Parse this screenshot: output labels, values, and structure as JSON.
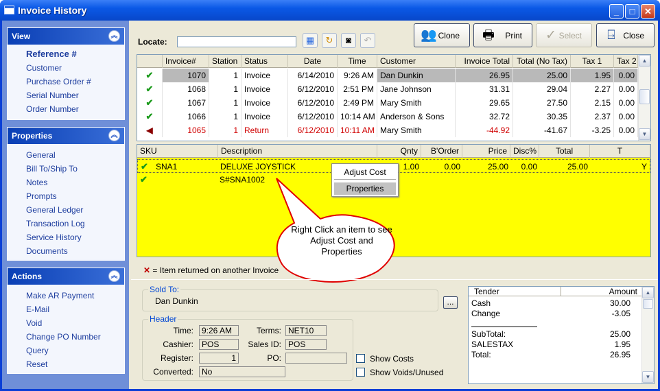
{
  "window": {
    "title": "Invoice History"
  },
  "sidebar": {
    "view": {
      "title": "View",
      "items": [
        "Reference #",
        "Customer",
        "Purchase Order #",
        "Serial Number",
        "Order Number"
      ]
    },
    "properties": {
      "title": "Properties",
      "items": [
        "General",
        "Bill To/Ship To",
        "Notes",
        "Prompts",
        "General Ledger",
        "Transaction Log",
        "Service History",
        "Documents"
      ]
    },
    "actions": {
      "title": "Actions",
      "items": [
        "Make AR Payment",
        "E-Mail",
        "Void",
        "Change PO Number",
        "Query",
        "Reset"
      ]
    }
  },
  "toolbar": {
    "locate_label": "Locate:",
    "locate_value": "",
    "clone": "Clone",
    "print": "Print",
    "select": "Select",
    "close": "Close"
  },
  "invoices": {
    "columns": [
      "Invoice#",
      "Station",
      "Status",
      "Date",
      "Time",
      "Customer",
      "Invoice Total",
      "Total (No Tax)",
      "Tax 1",
      "Tax 2"
    ],
    "rows": [
      {
        "invoice": "1070",
        "station": "1",
        "status": "Invoice",
        "date": "6/14/2010",
        "time": "9:26 AM",
        "customer": "Dan Dunkin",
        "total": "26.95",
        "notax": "25.00",
        "tax1": "1.95",
        "tax2": "0.00"
      },
      {
        "invoice": "1068",
        "station": "1",
        "status": "Invoice",
        "date": "6/12/2010",
        "time": "2:51 PM",
        "customer": "Jane Johnson",
        "total": "31.31",
        "notax": "29.04",
        "tax1": "2.27",
        "tax2": "0.00"
      },
      {
        "invoice": "1067",
        "station": "1",
        "status": "Invoice",
        "date": "6/12/2010",
        "time": "2:49 PM",
        "customer": "Mary Smith",
        "total": "29.65",
        "notax": "27.50",
        "tax1": "2.15",
        "tax2": "0.00"
      },
      {
        "invoice": "1066",
        "station": "1",
        "status": "Invoice",
        "date": "6/12/2010",
        "time": "10:14 AM",
        "customer": "Anderson & Sons",
        "total": "32.72",
        "notax": "30.35",
        "tax1": "2.37",
        "tax2": "0.00"
      },
      {
        "invoice": "1065",
        "station": "1",
        "status": "Return",
        "date": "6/12/2010",
        "time": "10:11 AM",
        "customer": "Mary Smith",
        "total": "-44.92",
        "notax": "-41.67",
        "tax1": "-3.25",
        "tax2": "0.00"
      }
    ]
  },
  "items": {
    "columns": [
      "SKU",
      "Description",
      "Qnty",
      "B'Order",
      "Price",
      "Disc%",
      "Total",
      "T"
    ],
    "rows": [
      {
        "sku": "SNA1",
        "desc": "DELUXE JOYSTICK",
        "qty": "1.00",
        "border": "0.00",
        "price": "25.00",
        "disc": "0.00",
        "total": "25.00",
        "t": "Y"
      },
      {
        "sku": "",
        "desc": "S#SNA1002",
        "qty": "",
        "border": "",
        "price": "",
        "disc": "",
        "total": "",
        "t": ""
      }
    ]
  },
  "context_menu": {
    "adjust_cost": "Adjust Cost",
    "properties": "Properties"
  },
  "callout": {
    "text": "Right Click an item to see Adjust Cost and Properties"
  },
  "legend": {
    "text": "= Item returned on another Invoice"
  },
  "sold_to": {
    "label": "Sold To:",
    "name": "Dan Dunkin",
    "more": "..."
  },
  "header": {
    "label": "Header",
    "time_label": "Time:",
    "time": "9:26 AM",
    "terms_label": "Terms:",
    "terms": "NET10",
    "cashier_label": "Cashier:",
    "cashier": "POS",
    "salesid_label": "Sales ID:",
    "salesid": "POS",
    "register_label": "Register:",
    "register": "1",
    "po_label": "PO:",
    "po": "",
    "converted_label": "Converted:",
    "converted": "No"
  },
  "options": {
    "show_costs": "Show Costs",
    "show_voids": "Show Voids/Unused"
  },
  "tender": {
    "col1": "Tender",
    "col2": "Amount",
    "rows": [
      {
        "label": "Cash",
        "amount": "30.00"
      },
      {
        "label": "Change",
        "amount": "-3.05"
      },
      {
        "label": "SubTotal:",
        "amount": "25.00"
      },
      {
        "label": "SALESTAX",
        "amount": "1.95"
      },
      {
        "label": "Total:",
        "amount": "26.95"
      }
    ]
  }
}
